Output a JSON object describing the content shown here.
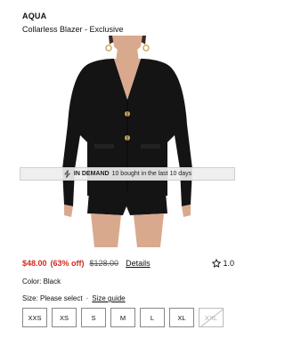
{
  "product": {
    "brand": "AQUA",
    "name": "Collarless Blazer - Exclusive"
  },
  "badge": {
    "strong": "IN DEMAND",
    "text": "10 bought in the last 10 days",
    "icon": "lightning-bolt-icon"
  },
  "pricing": {
    "sale": "$48.00",
    "percent_off": "(63% off)",
    "original": "$128.00",
    "details_label": "Details"
  },
  "rating": {
    "value": "1.0",
    "icon": "star-outline-icon"
  },
  "color": {
    "label": "Color: Black"
  },
  "size": {
    "prompt": "Size: Please select",
    "separator": "·",
    "guide_label": "Size guide",
    "options": [
      {
        "label": "XXS",
        "available": true
      },
      {
        "label": "XS",
        "available": true
      },
      {
        "label": "S",
        "available": true
      },
      {
        "label": "M",
        "available": true
      },
      {
        "label": "L",
        "available": true
      },
      {
        "label": "XL",
        "available": true
      },
      {
        "label": "XXL",
        "available": false
      }
    ]
  },
  "colors": {
    "sale_red": "#d22a1e",
    "garment_black": "#141414",
    "skin": "#d9a98e",
    "gold_button": "#c9a862"
  }
}
